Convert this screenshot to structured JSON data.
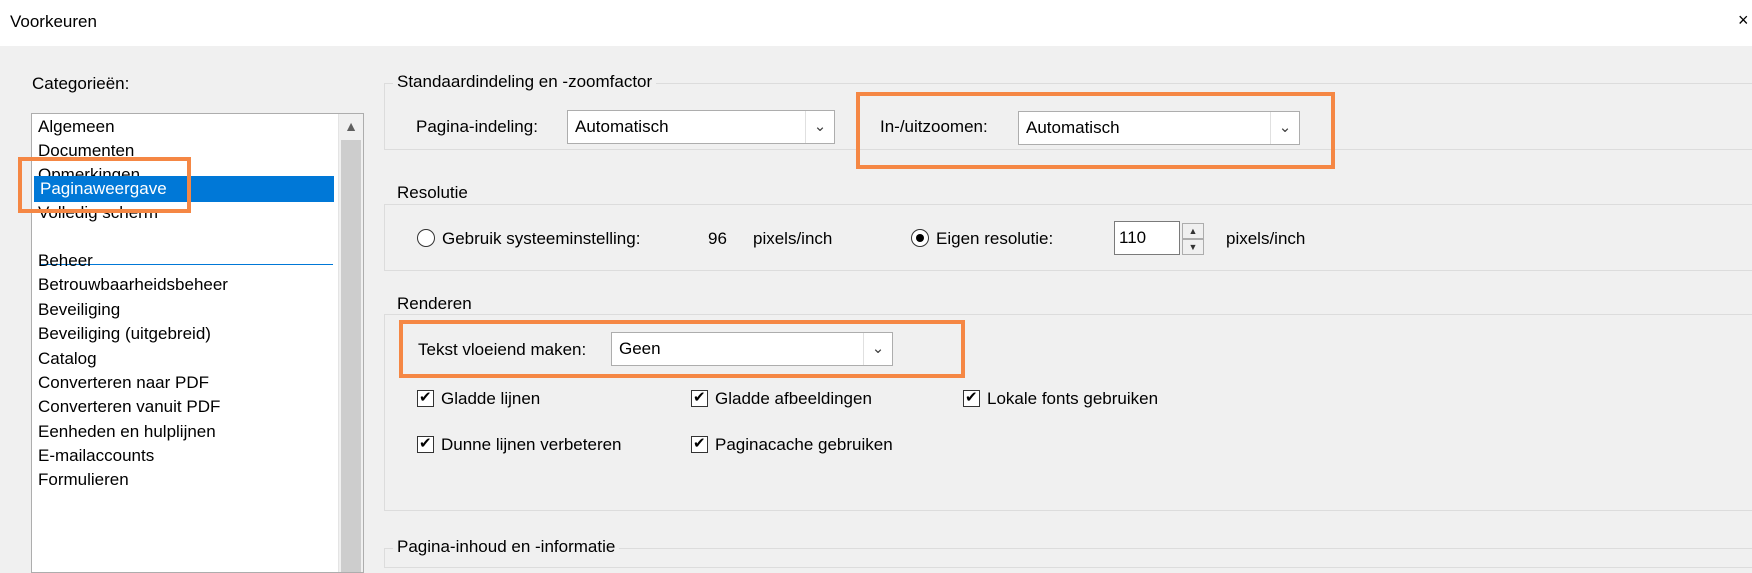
{
  "window": {
    "title": "Voorkeuren",
    "close_glyph": "×"
  },
  "categories": {
    "label": "Categorieën:",
    "top_items": [
      "Algemeen",
      "Documenten",
      "Opmerkingen",
      "Paginaweergave",
      "Volledig scherm"
    ],
    "selected": "Paginaweergave",
    "other_items": [
      "Beheer",
      "Betrouwbaarheidsbeheer",
      "Beveiliging",
      "Beveiliging (uitgebreid)",
      "Catalog",
      "Converteren naar PDF",
      "Converteren vanuit PDF",
      "Eenheden en hulplijnen",
      "E-mailaccounts",
      "Formulieren"
    ]
  },
  "layout_zoom": {
    "title": "Standaardindeling en -zoomfactor",
    "page_layout_label": "Pagina-indeling:",
    "page_layout_value": "Automatisch",
    "zoom_label": "In-/uitzoomen:",
    "zoom_value": "Automatisch"
  },
  "resolution": {
    "title": "Resolutie",
    "system_label": "Gebruik systeeminstelling:",
    "system_value": "96",
    "system_unit": "pixels/inch",
    "custom_label": "Eigen resolutie:",
    "custom_value": "110",
    "custom_unit": "pixels/inch",
    "selected_option": "custom"
  },
  "rendering": {
    "title": "Renderen",
    "smooth_text_label": "Tekst vloeiend maken:",
    "smooth_text_value": "Geen",
    "checkboxes": [
      {
        "label": "Gladde lijnen",
        "checked": true
      },
      {
        "label": "Gladde afbeeldingen",
        "checked": true
      },
      {
        "label": "Lokale fonts gebruiken",
        "checked": true
      },
      {
        "label": "Dunne lijnen verbeteren",
        "checked": true
      },
      {
        "label": "Paginacache gebruiken",
        "checked": true
      }
    ]
  },
  "page_content": {
    "title": "Pagina-inhoud en -informatie"
  },
  "icons": {
    "dropdown": "chevron-down-icon",
    "scroll_up": "arrow-up-icon",
    "check": "checkmark-icon"
  },
  "colors": {
    "selection": "#0078d7",
    "highlight": "#f58744",
    "background": "#f0f0f0"
  }
}
